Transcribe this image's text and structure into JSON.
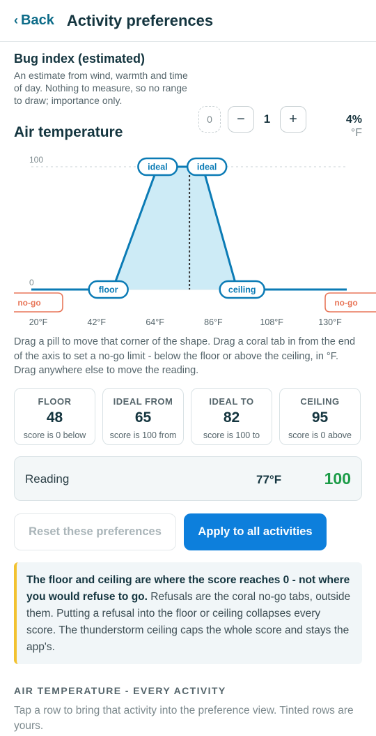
{
  "header": {
    "back_label": "Back",
    "title": "Activity preferences"
  },
  "bug": {
    "title": "Bug index (estimated)",
    "description": "An estimate from wind, warmth and time of day. Nothing to measure, so no range to draw; importance only.",
    "min_value": "0",
    "minus_label": "−",
    "value": "1",
    "plus_label": "+",
    "percent": "4%"
  },
  "air": {
    "title": "Air temperature",
    "unit": "°F"
  },
  "chart_data": {
    "type": "area",
    "x_axis": {
      "min": 20,
      "max": 130,
      "ticks": [
        20,
        42,
        64,
        86,
        108,
        130
      ],
      "tick_labels": [
        "20°F",
        "42°F",
        "64°F",
        "86°F",
        "108°F",
        "130°F"
      ]
    },
    "y_axis": {
      "min": 0,
      "max": 100,
      "tick_labels": [
        "0",
        "100"
      ]
    },
    "shape": {
      "floor": 48,
      "ideal_from": 65,
      "ideal_to": 82,
      "ceiling": 95
    },
    "reading": 77,
    "pills": {
      "floor": "floor",
      "ideal_from": "ideal",
      "ideal_to": "ideal",
      "ceiling": "ceiling"
    },
    "nogo_label": "no-go",
    "colors": {
      "line": "#0b7bb5",
      "fill": "#cdebf6",
      "nogo": "#e8775a",
      "reading": "#333333"
    }
  },
  "hint": "Drag a pill to move that corner of the shape. Drag a coral tab in from the end of the axis to set a no-go limit - below the floor or above the ceiling, in °F. Drag anywhere else to move the reading.",
  "cards": [
    {
      "label": "FLOOR",
      "value": "48",
      "sub": "score is 0 below"
    },
    {
      "label": "IDEAL FROM",
      "value": "65",
      "sub": "score is 100 from"
    },
    {
      "label": "IDEAL TO",
      "value": "82",
      "sub": "score is 100 to"
    },
    {
      "label": "CEILING",
      "value": "95",
      "sub": "score is 0 above"
    }
  ],
  "reading": {
    "label": "Reading",
    "temp": "77°F",
    "score": "100"
  },
  "buttons": {
    "reset": "Reset these preferences",
    "apply": "Apply to all activities"
  },
  "note": {
    "bold": "The floor and ceiling are where the score reaches 0 - not where you would refuse to go.",
    "rest": " Refusals are the coral no-go tabs, outside them. Putting a refusal into the floor or ceiling collapses every score. The thunderstorm ceiling caps the whole score and stays the app's."
  },
  "list": {
    "heading": "AIR TEMPERATURE - EVERY ACTIVITY",
    "description": "Tap a row to bring that activity into the preference view. Tinted rows are yours."
  }
}
